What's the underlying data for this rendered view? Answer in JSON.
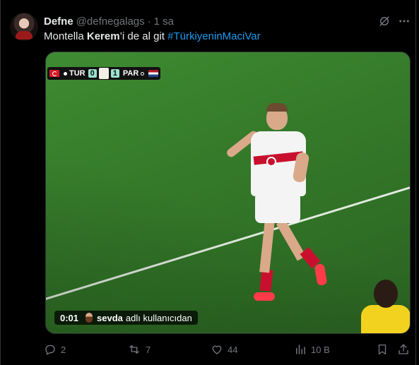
{
  "tweet": {
    "author": {
      "display_name": "Defne",
      "handle": "@defnegalags"
    },
    "separator": "·",
    "time": "1 sa",
    "text": {
      "part1": "Montella ",
      "bold": "Kerem",
      "part2": "’i de al git ",
      "hashtag": "#TürkiyeninMaciVar"
    },
    "media": {
      "scorebug": {
        "home": "TUR",
        "home_score": "0",
        "away_score": "1",
        "away": "PAR"
      },
      "caption": {
        "timecode": "0:01",
        "user": "sevda",
        "suffix": "adlı kullanıcıdan"
      }
    },
    "actions": {
      "replies": "2",
      "reposts": "7",
      "likes": "44",
      "views": "10 B"
    }
  },
  "icons": [
    "grok-icon",
    "more-icon",
    "reply-icon",
    "repost-icon",
    "like-icon",
    "views-icon",
    "bookmark-icon",
    "share-icon"
  ],
  "colors": {
    "background": "#000000",
    "text": "#e7e9ea",
    "secondary": "#71767b",
    "accent": "#1d9bf0"
  }
}
